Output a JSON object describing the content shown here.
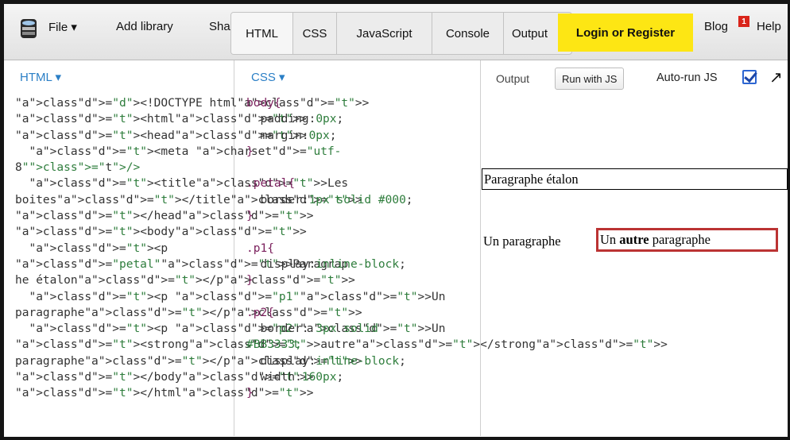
{
  "toolbar": {
    "file_label": "File ▾",
    "add_library_label": "Add library",
    "share_label": "Share",
    "tabs": [
      "HTML",
      "CSS",
      "JavaScript",
      "Console",
      "Output"
    ],
    "login_label": "Login or Register",
    "blog_label": "Blog",
    "blog_badge": "1",
    "help_label": "Help"
  },
  "html_pane": {
    "title": "HTML ▾",
    "code_lines": [
      "<!DOCTYPE html>",
      "<html>",
      "<head>",
      "  <meta charset=\"utf-",
      "8\"/>",
      "  <title>Les",
      "boites</title>",
      "</head>",
      "<body>",
      "  <p",
      "class=\"petal\">Paragrap",
      "he étalon</p>",
      "  <p class=\"p1\">Un",
      "paragraphe</p>",
      "  <p class=\"p2\">Un",
      "<strong>autre</strong>",
      "paragraphe</p>",
      "</body>",
      "</html>"
    ]
  },
  "css_pane": {
    "title": "CSS ▾",
    "code_lines": [
      "body{",
      "  padding:0px;",
      "  margin:0px;",
      "}",
      "",
      ".petal{",
      "  border:1px solid #000;",
      "}",
      "",
      ".p1{",
      "  display:inline-block;",
      "}",
      "",
      ".p2{",
      "  border: 3px solid",
      "#BB3333;",
      "  display:inline-block;",
      "  width:160px;",
      "}"
    ]
  },
  "output_pane": {
    "label": "Output",
    "run_button": "Run with JS",
    "autorun_label": "Auto-run JS",
    "autorun_checked": true,
    "petal_text": "Paragraphe étalon",
    "p1_text": "Un paragraphe",
    "p2_before": "Un ",
    "p2_strong": "autre",
    "p2_after": " paragraphe"
  },
  "colors": {
    "accent_blue": "#2b7fc6",
    "login_yellow": "#fde614",
    "p2_border": "#BB3333"
  }
}
